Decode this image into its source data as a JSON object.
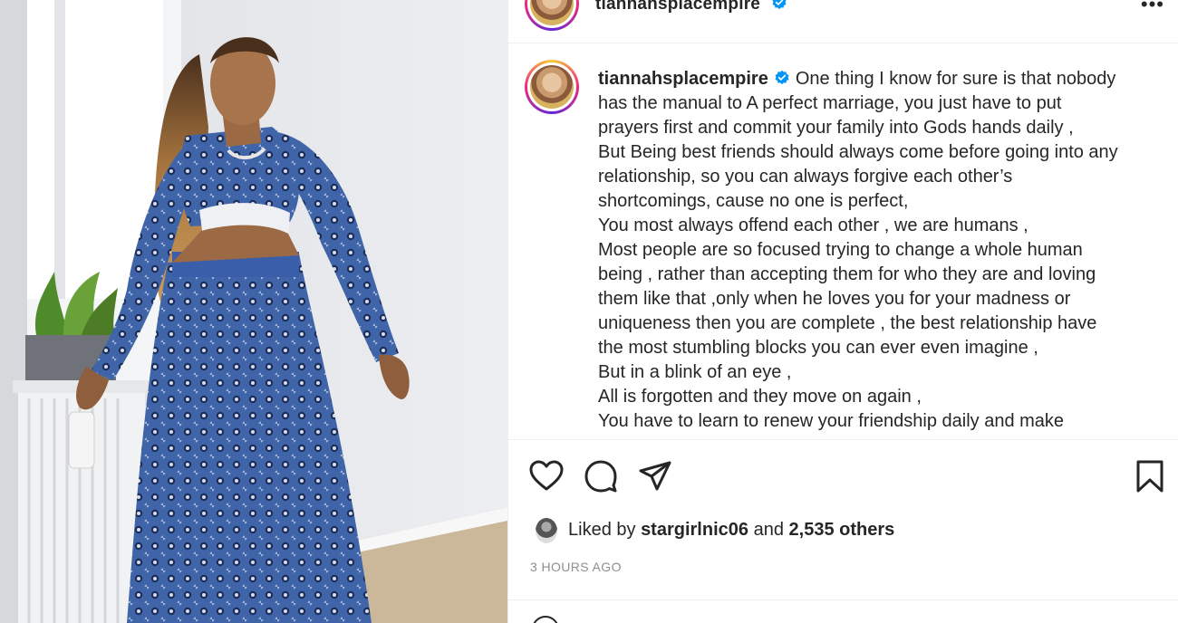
{
  "post": {
    "username": "tiannahsplacempire",
    "verified": true,
    "more_label": "•••",
    "caption_lines": [
      "One thing I know for sure is that nobody",
      "has the manual to A perfect marriage, you just have to put",
      "prayers first and commit your family into Gods hands daily ,",
      "But Being best friends should always come before going into any",
      "relationship, so you can always forgive each other’s",
      "shortcomings, cause no one is perfect,",
      "You most always offend each other , we are humans ,",
      "Most people are so focused trying to change a whole human",
      "being , rather than accepting them for who they are and loving",
      "them like that ,only when he loves you for your madness or",
      "uniqueness then you are complete , the best relationship have",
      "the most stumbling blocks you can ever even imagine ,",
      "But in a blink of an eye ,",
      "All is forgotten and they move on again ,",
      "You have to learn to renew your friendship daily and make"
    ],
    "likes": {
      "prefix": "Liked by",
      "liker": "stargirlnic06",
      "joiner": "and",
      "others": "2,535 others"
    },
    "timestamp": "3 HOURS AGO"
  },
  "icons": {
    "like": "heart-icon",
    "comment": "comment-icon",
    "share": "send-icon",
    "save": "bookmark-icon",
    "verified": "verified-badge-icon"
  },
  "colors": {
    "verified_blue": "#0095f6",
    "text": "#262626",
    "muted": "#8e8e8e",
    "divider": "#efefef"
  }
}
